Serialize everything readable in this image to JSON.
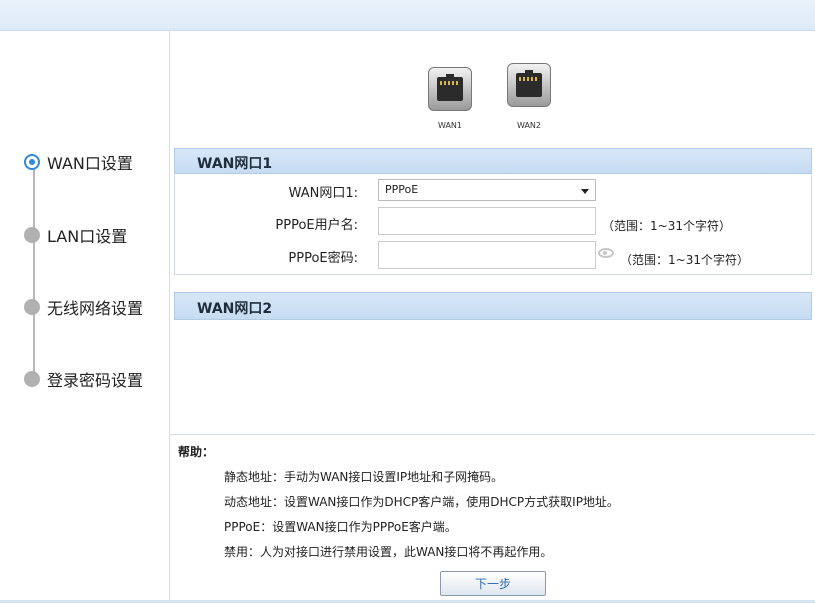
{
  "sidebar": {
    "steps": [
      {
        "label": "WAN口设置",
        "active": true
      },
      {
        "label": "LAN口设置",
        "active": false
      },
      {
        "label": "无线网络设置",
        "active": false
      },
      {
        "label": "登录密码设置",
        "active": false
      }
    ]
  },
  "ports": [
    {
      "label": "WAN1",
      "icon": "ethernet-port-icon"
    },
    {
      "label": "WAN2",
      "icon": "ethernet-port-icon"
    }
  ],
  "wan1": {
    "title": "WAN网口1",
    "type_label": "WAN网口1:",
    "type_value": "PPPoE",
    "username_label": "PPPoE用户名:",
    "username_value": "",
    "username_hint": "（范围：1~31个字符）",
    "password_label": "PPPoE密码:",
    "password_value": "",
    "password_hint": "（范围：1~31个字符）"
  },
  "wan2": {
    "title": "WAN网口2"
  },
  "help": {
    "title": "帮助：",
    "lines": [
      "静态地址：手动为WAN接口设置IP地址和子网掩码。",
      "动态地址：设置WAN接口作为DHCP客户端，使用DHCP方式获取IP地址。",
      "PPPoE：设置WAN接口作为PPPoE客户端。",
      "禁用：人为对接口进行禁用设置，此WAN接口将不再起作用。"
    ]
  },
  "buttons": {
    "next": "下一步"
  },
  "colors": {
    "accent": "#2f8ad7",
    "section_header": "#c6dcf2"
  }
}
